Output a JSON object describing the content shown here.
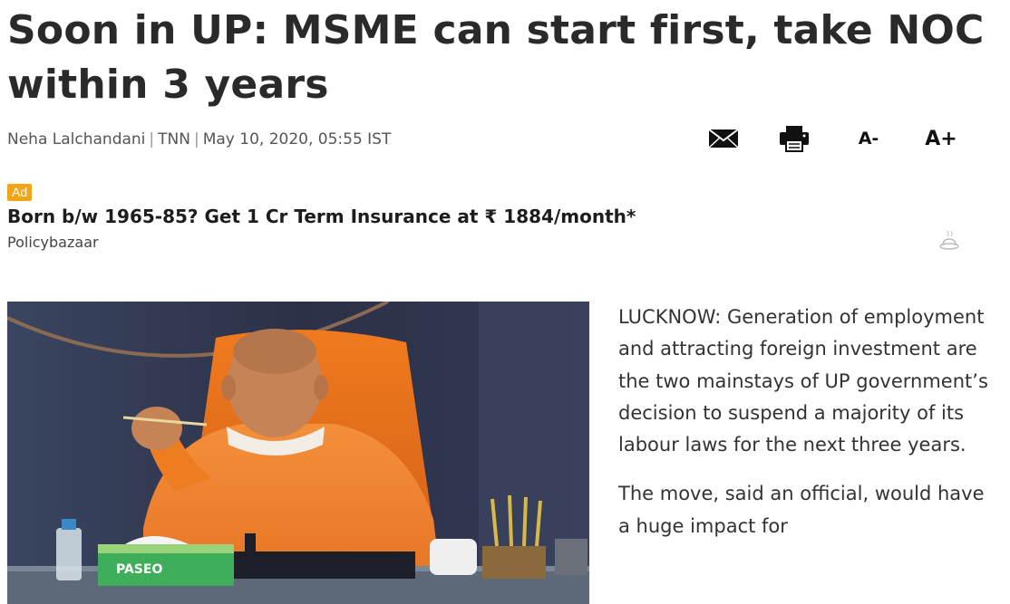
{
  "article": {
    "headline": "Soon in UP: MSME can start first, take NOC within 3 years",
    "byline": {
      "author": "Neha Lalchandani",
      "source": "TNN",
      "datetime": "May 10, 2020, 05:55 IST"
    },
    "tools": {
      "mail_icon": "mail-icon",
      "print_icon": "print-icon",
      "font_decrease": "A-",
      "font_increase": "A+"
    },
    "paragraphs": [
      "LUCKNOW: Generation of employment and attracting foreign investment are the two mainstays of UP government’s decision to suspend a majority of its labour laws for the next three years.",
      "The move, said an official, would have a huge impact for"
    ]
  },
  "ad": {
    "badge": "Ad",
    "title": "Born b/w 1965-85? Get 1 Cr Term Insurance at ₹ 1884/month*",
    "source": "Policybazaar",
    "icon": "adchoices-icon"
  },
  "photo": {
    "tissue_box_text": "PASEO"
  },
  "colors": {
    "ad_badge": "#f2a516",
    "headline": "#2a2a2a",
    "saffron": "#ee7d22"
  }
}
